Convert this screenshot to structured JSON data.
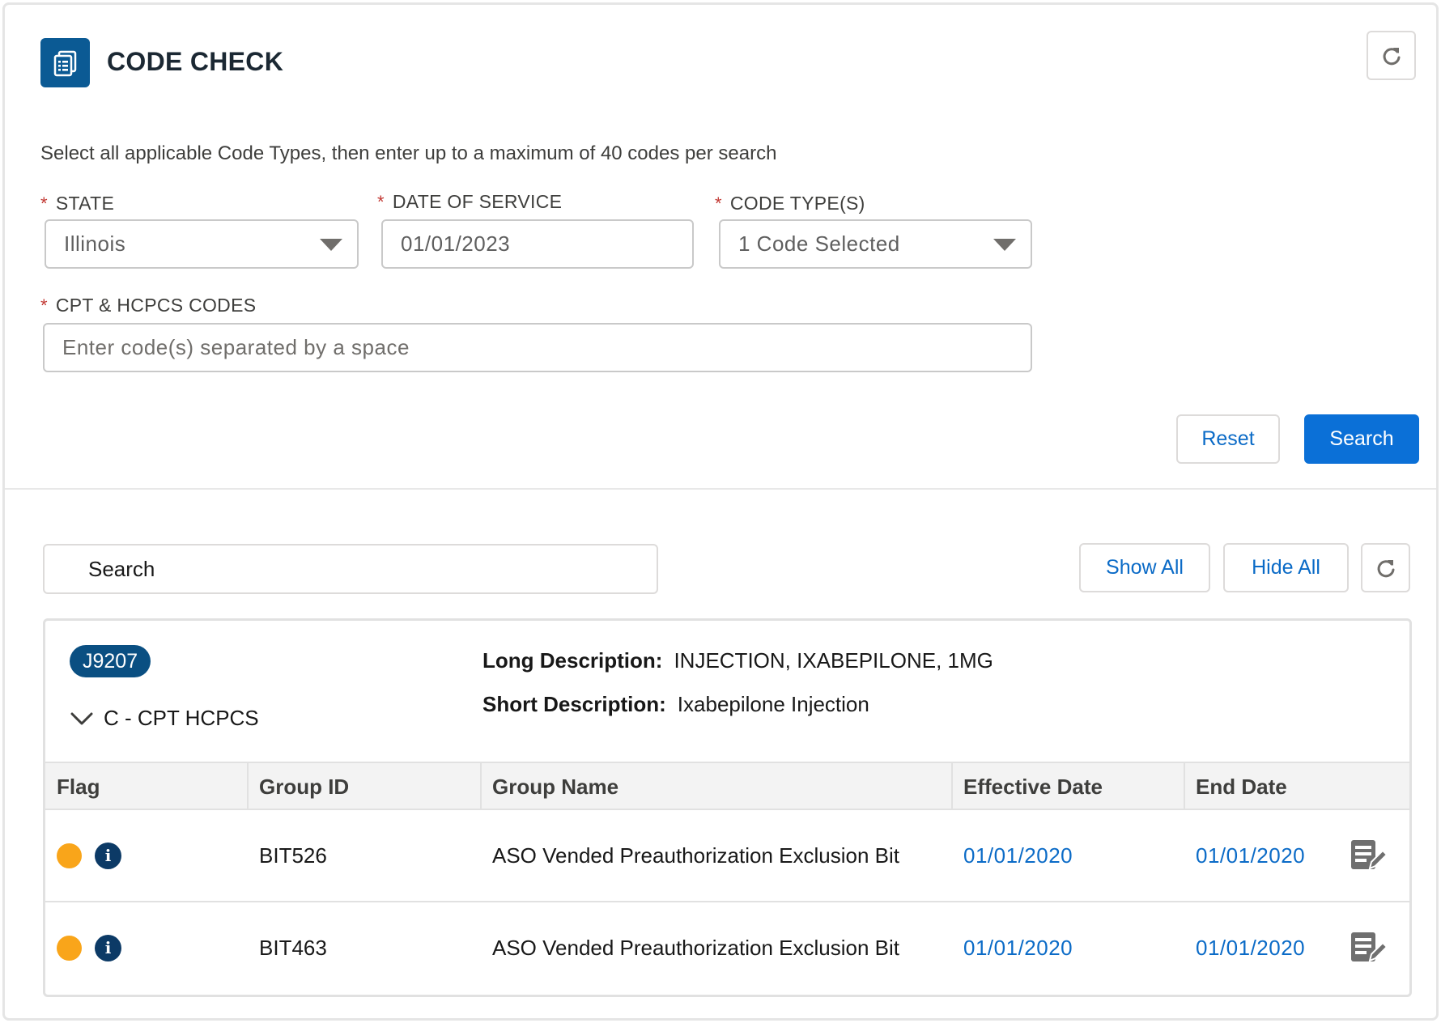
{
  "header": {
    "title": "CODE CHECK",
    "icon": "document-list-icon"
  },
  "form": {
    "instructions": "Select all applicable Code Types, then enter up to a maximum of 40 codes per search",
    "state": {
      "label": "STATE",
      "value": "Illinois",
      "required": "*"
    },
    "date_of_service": {
      "label": "DATE OF SERVICE",
      "value": "01/01/2023",
      "required": "*"
    },
    "code_types": {
      "label": "CODE TYPE(S)",
      "value": "1 Code Selected",
      "required": "*"
    },
    "codes": {
      "label": "CPT & HCPCS CODES",
      "placeholder": "Enter code(s) separated by a space",
      "required": "*"
    },
    "reset_label": "Reset",
    "search_label": "Search"
  },
  "results": {
    "search_placeholder": "Search",
    "show_all_label": "Show All",
    "hide_all_label": "Hide All",
    "card": {
      "code": "J9207",
      "code_type": "C - CPT HCPCS",
      "long_desc_label": "Long Description:",
      "long_desc": "INJECTION, IXABEPILONE, 1MG",
      "short_desc_label": "Short Description:",
      "short_desc": "Ixabepilone Injection",
      "columns": [
        "Flag",
        "Group ID",
        "Group Name",
        "Effective Date",
        "End Date"
      ],
      "rows": [
        {
          "group_id": "BIT526",
          "group_name": "ASO Vended Preauthorization Exclusion Bit",
          "effective_date": "01/01/2020",
          "end_date": "01/01/2020",
          "flag_color": "#f9a51a"
        },
        {
          "group_id": "BIT463",
          "group_name": "ASO Vended Preauthorization Exclusion Bit",
          "effective_date": "01/01/2020",
          "end_date": "01/01/2020",
          "flag_color": "#f9a51a"
        }
      ]
    }
  },
  "colors": {
    "brand": "#0b70d7",
    "link": "#0b6bc7",
    "pill": "#0a4f82",
    "flag": "#f9a51a",
    "required": "#c23934"
  }
}
